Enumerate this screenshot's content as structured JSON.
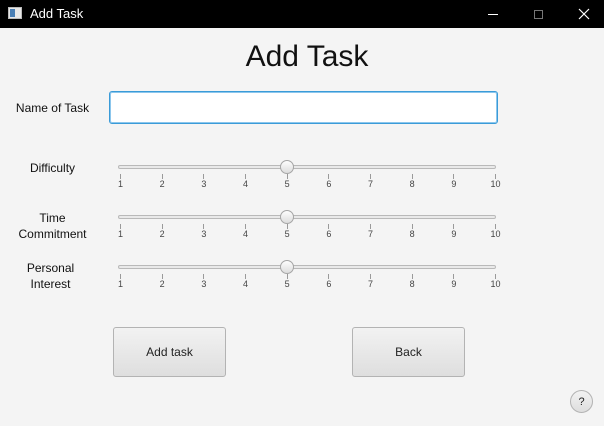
{
  "window": {
    "title": "Add Task",
    "minimize_label": "",
    "maximize_label": "",
    "close_label": ""
  },
  "form": {
    "heading": "Add Task",
    "name_label": "Name of Task",
    "name_value": "",
    "sliders": [
      {
        "label_line1": "Difficulty",
        "label_line2": "",
        "value": 5,
        "min": 1,
        "max": 10
      },
      {
        "label_line1": "Time",
        "label_line2": "Commitment",
        "value": 5,
        "min": 1,
        "max": 10
      },
      {
        "label_line1": "Personal",
        "label_line2": "Interest",
        "value": 5,
        "min": 1,
        "max": 10
      }
    ],
    "tick_labels": [
      "1",
      "2",
      "3",
      "4",
      "5",
      "6",
      "7",
      "8",
      "9",
      "10"
    ]
  },
  "buttons": {
    "add_label": "Add task",
    "back_label": "Back",
    "help_label": "?"
  }
}
